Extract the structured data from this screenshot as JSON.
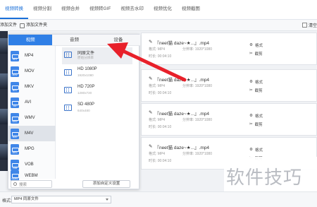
{
  "topnav": {
    "tabs": [
      {
        "label": "视频转换",
        "active": true
      },
      {
        "label": "视频分割",
        "active": false
      },
      {
        "label": "视频合并",
        "active": false
      },
      {
        "label": "视频转GIF",
        "active": false
      },
      {
        "label": "视频去水印",
        "active": false
      },
      {
        "label": "视频优化",
        "active": false
      },
      {
        "label": "视频截图",
        "active": false
      }
    ]
  },
  "toolbar": {
    "add_file": "添加文件",
    "add_folder": "添加文件夹",
    "clear": "清空"
  },
  "popup": {
    "tabs": [
      "视频",
      "音频",
      "设备"
    ],
    "active_tab": "视频",
    "formats": [
      {
        "label": "MP4",
        "active": false
      },
      {
        "label": "MOV",
        "active": false
      },
      {
        "label": "MKV",
        "active": false
      },
      {
        "label": "AVI",
        "active": false
      },
      {
        "label": "WMV",
        "active": false
      },
      {
        "label": "M4V",
        "active": true
      },
      {
        "label": "MPG",
        "active": false
      },
      {
        "label": "VOB",
        "active": false
      },
      {
        "label": "WEBM",
        "active": false
      }
    ],
    "search_placeholder": "搜索",
    "presets": [
      {
        "title": "同原文件",
        "sub": "原始分辨率",
        "active": true
      },
      {
        "title": "HD 1080P",
        "sub": "1920x1080",
        "active": false
      },
      {
        "title": "HD 720P",
        "sub": "1280x720",
        "active": false
      },
      {
        "title": "SD 480P",
        "sub": "640x480",
        "active": false
      }
    ],
    "custom_button": "添加自定义设置"
  },
  "files": [
    {
      "name": "『neet猫 daze~★...』.mp4",
      "format_label": "格式:",
      "format": "MP4",
      "res_label": "分辨率:",
      "resolution": "1920*1080",
      "time_label": "时长:",
      "duration": "00:04:10",
      "format_button": "格式",
      "cut_button": "截剪"
    },
    {
      "name": "『neet猫 daze~★...』.mp4",
      "format_label": "格式:",
      "format": "MP4",
      "res_label": "分辨率:",
      "resolution": "1920*1080",
      "time_label": "时长:",
      "duration": "00:04:10",
      "format_button": "格式",
      "cut_button": "截剪"
    },
    {
      "name": "『neet猫 daze~★...』.mp4",
      "format_label": "格式:",
      "format": "MP4",
      "res_label": "分辨率:",
      "resolution": "1920*1080",
      "time_label": "时长:",
      "duration": "00:04:10",
      "format_button": "格式",
      "cut_button": "截剪"
    },
    {
      "name": "『neet猫 daze~★...』.mp4",
      "format_label": "格式:",
      "format": "MP4",
      "res_label": "分辨率:",
      "resolution": "1920*1080",
      "time_label": "时长:",
      "duration": "00:04:10",
      "format_button": "格式",
      "cut_button": "截剪"
    }
  ],
  "bottombar": {
    "label": "格式:",
    "value": "MP4 同原文件"
  },
  "watermark": "软件技巧",
  "colors": {
    "accent": "#2f7fe6",
    "arrow": "#e8202a",
    "format_icon": "#3f86e8"
  }
}
